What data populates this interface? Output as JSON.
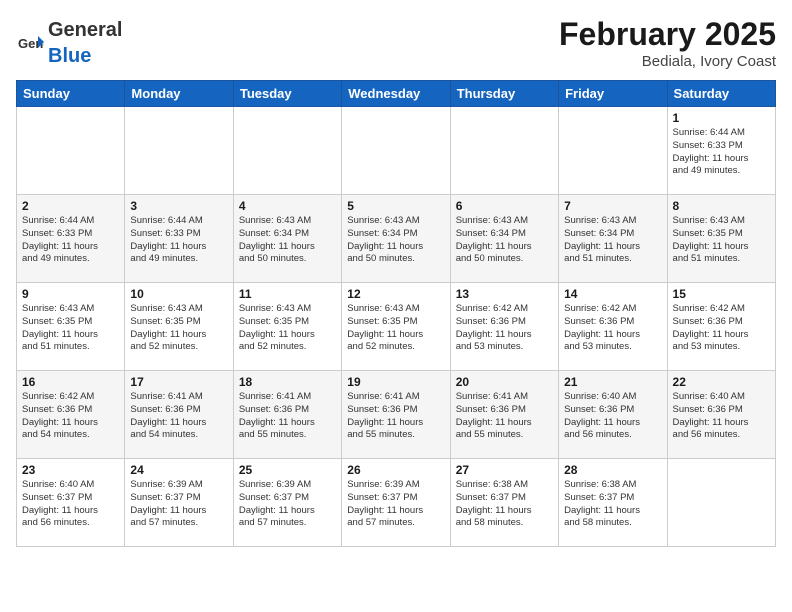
{
  "header": {
    "logo_general": "General",
    "logo_blue": "Blue",
    "month_title": "February 2025",
    "location": "Bediala, Ivory Coast"
  },
  "days_of_week": [
    "Sunday",
    "Monday",
    "Tuesday",
    "Wednesday",
    "Thursday",
    "Friday",
    "Saturday"
  ],
  "weeks": [
    [
      {
        "day": "",
        "info": ""
      },
      {
        "day": "",
        "info": ""
      },
      {
        "day": "",
        "info": ""
      },
      {
        "day": "",
        "info": ""
      },
      {
        "day": "",
        "info": ""
      },
      {
        "day": "",
        "info": ""
      },
      {
        "day": "1",
        "info": "Sunrise: 6:44 AM\nSunset: 6:33 PM\nDaylight: 11 hours\nand 49 minutes."
      }
    ],
    [
      {
        "day": "2",
        "info": "Sunrise: 6:44 AM\nSunset: 6:33 PM\nDaylight: 11 hours\nand 49 minutes."
      },
      {
        "day": "3",
        "info": "Sunrise: 6:44 AM\nSunset: 6:33 PM\nDaylight: 11 hours\nand 49 minutes."
      },
      {
        "day": "4",
        "info": "Sunrise: 6:43 AM\nSunset: 6:34 PM\nDaylight: 11 hours\nand 50 minutes."
      },
      {
        "day": "5",
        "info": "Sunrise: 6:43 AM\nSunset: 6:34 PM\nDaylight: 11 hours\nand 50 minutes."
      },
      {
        "day": "6",
        "info": "Sunrise: 6:43 AM\nSunset: 6:34 PM\nDaylight: 11 hours\nand 50 minutes."
      },
      {
        "day": "7",
        "info": "Sunrise: 6:43 AM\nSunset: 6:34 PM\nDaylight: 11 hours\nand 51 minutes."
      },
      {
        "day": "8",
        "info": "Sunrise: 6:43 AM\nSunset: 6:35 PM\nDaylight: 11 hours\nand 51 minutes."
      }
    ],
    [
      {
        "day": "9",
        "info": "Sunrise: 6:43 AM\nSunset: 6:35 PM\nDaylight: 11 hours\nand 51 minutes."
      },
      {
        "day": "10",
        "info": "Sunrise: 6:43 AM\nSunset: 6:35 PM\nDaylight: 11 hours\nand 52 minutes."
      },
      {
        "day": "11",
        "info": "Sunrise: 6:43 AM\nSunset: 6:35 PM\nDaylight: 11 hours\nand 52 minutes."
      },
      {
        "day": "12",
        "info": "Sunrise: 6:43 AM\nSunset: 6:35 PM\nDaylight: 11 hours\nand 52 minutes."
      },
      {
        "day": "13",
        "info": "Sunrise: 6:42 AM\nSunset: 6:36 PM\nDaylight: 11 hours\nand 53 minutes."
      },
      {
        "day": "14",
        "info": "Sunrise: 6:42 AM\nSunset: 6:36 PM\nDaylight: 11 hours\nand 53 minutes."
      },
      {
        "day": "15",
        "info": "Sunrise: 6:42 AM\nSunset: 6:36 PM\nDaylight: 11 hours\nand 53 minutes."
      }
    ],
    [
      {
        "day": "16",
        "info": "Sunrise: 6:42 AM\nSunset: 6:36 PM\nDaylight: 11 hours\nand 54 minutes."
      },
      {
        "day": "17",
        "info": "Sunrise: 6:41 AM\nSunset: 6:36 PM\nDaylight: 11 hours\nand 54 minutes."
      },
      {
        "day": "18",
        "info": "Sunrise: 6:41 AM\nSunset: 6:36 PM\nDaylight: 11 hours\nand 55 minutes."
      },
      {
        "day": "19",
        "info": "Sunrise: 6:41 AM\nSunset: 6:36 PM\nDaylight: 11 hours\nand 55 minutes."
      },
      {
        "day": "20",
        "info": "Sunrise: 6:41 AM\nSunset: 6:36 PM\nDaylight: 11 hours\nand 55 minutes."
      },
      {
        "day": "21",
        "info": "Sunrise: 6:40 AM\nSunset: 6:36 PM\nDaylight: 11 hours\nand 56 minutes."
      },
      {
        "day": "22",
        "info": "Sunrise: 6:40 AM\nSunset: 6:36 PM\nDaylight: 11 hours\nand 56 minutes."
      }
    ],
    [
      {
        "day": "23",
        "info": "Sunrise: 6:40 AM\nSunset: 6:37 PM\nDaylight: 11 hours\nand 56 minutes."
      },
      {
        "day": "24",
        "info": "Sunrise: 6:39 AM\nSunset: 6:37 PM\nDaylight: 11 hours\nand 57 minutes."
      },
      {
        "day": "25",
        "info": "Sunrise: 6:39 AM\nSunset: 6:37 PM\nDaylight: 11 hours\nand 57 minutes."
      },
      {
        "day": "26",
        "info": "Sunrise: 6:39 AM\nSunset: 6:37 PM\nDaylight: 11 hours\nand 57 minutes."
      },
      {
        "day": "27",
        "info": "Sunrise: 6:38 AM\nSunset: 6:37 PM\nDaylight: 11 hours\nand 58 minutes."
      },
      {
        "day": "28",
        "info": "Sunrise: 6:38 AM\nSunset: 6:37 PM\nDaylight: 11 hours\nand 58 minutes."
      },
      {
        "day": "",
        "info": ""
      }
    ]
  ]
}
